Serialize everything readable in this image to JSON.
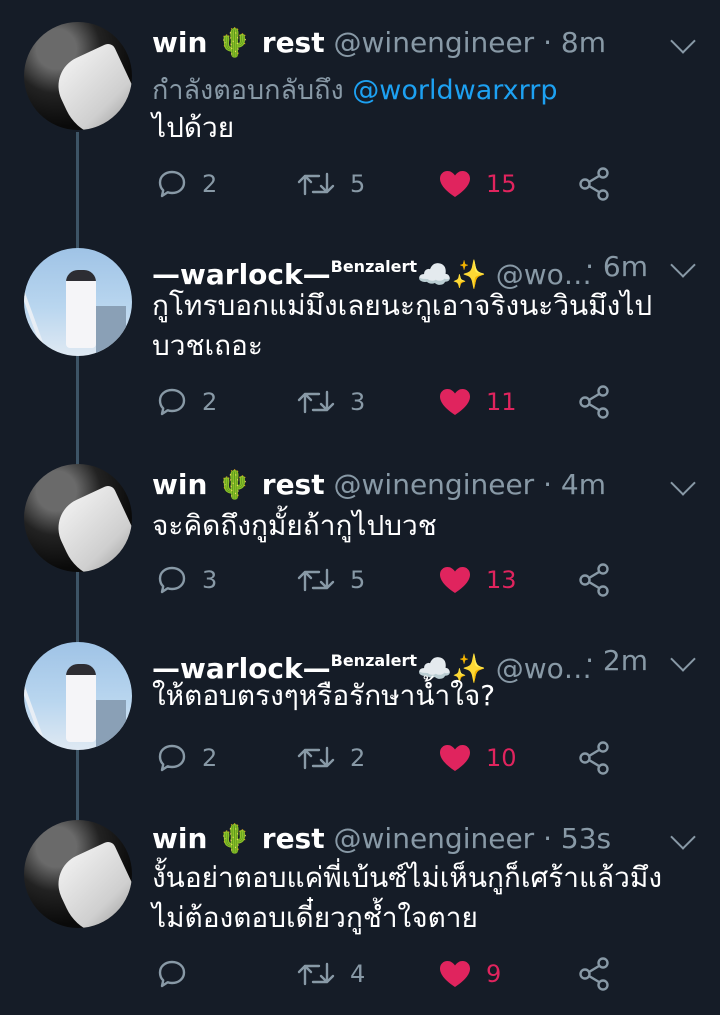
{
  "tweets": [
    {
      "name": "win 🌵 rest",
      "name_suffix": "",
      "handle": "@winengineer · 8m",
      "time_right": "",
      "replying_prefix": "กำลังตอบกลับถึง ",
      "replying_to": "@worldwarxrrp",
      "text": "ไปด้วย",
      "replies": "2",
      "retweets": "5",
      "likes": "15",
      "avatar": "bw"
    },
    {
      "name": "—warlock—",
      "name_suffix": "Benzalert",
      "name_emoji": "☁️✨",
      "handle": "@wo…",
      "time_right": "· 6m",
      "text": "กูโทรบอกแม่มึงเลยนะกูเอาจริงนะวินมึงไปบวชเถอะ",
      "replies": "2",
      "retweets": "3",
      "likes": "11",
      "avatar": "blue"
    },
    {
      "name": "win 🌵 rest",
      "name_suffix": "",
      "handle": "@winengineer · 4m",
      "time_right": "",
      "text": "จะคิดถึงกูมั้ยถ้ากูไปบวช",
      "replies": "3",
      "retweets": "5",
      "likes": "13",
      "avatar": "bw"
    },
    {
      "name": "—warlock—",
      "name_suffix": "Benzalert",
      "name_emoji": "☁️✨",
      "handle": "@wo…",
      "time_right": "· 2m",
      "text": "ให้ตอบตรงๆหรือรักษาน้ำใจ?",
      "replies": "2",
      "retweets": "2",
      "likes": "10",
      "avatar": "blue"
    },
    {
      "name": "win 🌵 rest",
      "name_suffix": "",
      "handle": "@winengineer · 53s",
      "time_right": "",
      "text": "งั้นอย่าตอบแค่พี่เบ้นซ์ไม่เห็นกูก็เศร้าแล้วมึงไม่ต้องตอบเดี๋ยวกูช้ำใจตาย",
      "replies": "",
      "retweets": "4",
      "likes": "9",
      "avatar": "bw"
    }
  ],
  "icons": {
    "reply": "reply-icon",
    "retweet": "retweet-icon",
    "like": "heart-icon",
    "share": "share-icon",
    "menu": "chevron-down-icon"
  },
  "colors": {
    "background": "#151c27",
    "secondary_text": "#8899a6",
    "link": "#1da1f2",
    "like": "#e0245e",
    "thread_line": "#3d5466"
  }
}
